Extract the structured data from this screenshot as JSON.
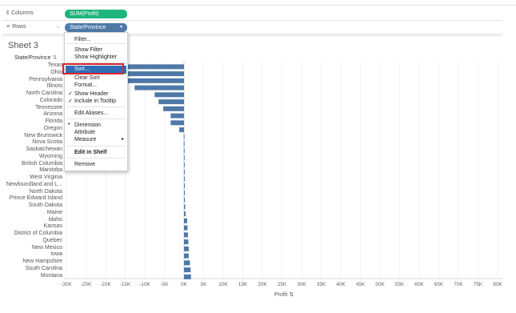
{
  "shelves": {
    "columns": {
      "label": "Columns",
      "icon": "columns-icon",
      "pill": "SUM(Profit)"
    },
    "rows": {
      "label": "Rows",
      "icon": "rows-icon",
      "pill": "State/Province",
      "pill_caret": "▾"
    }
  },
  "sheet": {
    "title": "Sheet 3",
    "row_header": "State/Province"
  },
  "menu": {
    "items": [
      {
        "label": "Filter..."
      },
      {
        "label": "Show Filter"
      },
      {
        "label": "Show Highlighter"
      },
      {
        "label": "Sort...",
        "highlighted": true
      },
      {
        "label": "Clear Sort"
      },
      {
        "label": "Format..."
      },
      {
        "label": "Show Header",
        "checked": true
      },
      {
        "label": "Include in Tooltip",
        "checked": true
      },
      {
        "label": "Edit Aliases..."
      },
      {
        "label": "Dimension",
        "selected": true
      },
      {
        "label": "Attribute"
      },
      {
        "label": "Measure",
        "submenu": true
      },
      {
        "label": "Edit in Shelf",
        "bold": true
      },
      {
        "label": "Remove"
      }
    ]
  },
  "colors": {
    "bar": "#4e79a7",
    "pill_green": "#1db57c",
    "pill_blue": "#4e79a7",
    "menu_highlight": "#2f6eb6",
    "sort_frame": "#d9232a"
  },
  "chart_data": {
    "type": "bar",
    "orientation": "horizontal",
    "xlabel": "Profit",
    "xlim": [
      -30000,
      80000
    ],
    "xticks": [
      "-30K",
      "-25K",
      "-20K",
      "-15K",
      "-10K",
      "-5K",
      "0K",
      "5K",
      "10K",
      "15K",
      "20K",
      "25K",
      "30K",
      "35K",
      "40K",
      "45K",
      "50K",
      "55K",
      "60K",
      "65K",
      "70K",
      "75K",
      "80K"
    ],
    "categories": [
      "Texas",
      "Ohio",
      "Pennsylvania",
      "Illinois",
      "North Carolina",
      "Colorado",
      "Tennessee",
      "Arizona",
      "Florida",
      "Oregon",
      "New Brunswick",
      "Nova Scotia",
      "Saskatchewan",
      "Wyoming",
      "British Columbia",
      "Manitoba",
      "West Virginia",
      "Newfoundland and L...",
      "North Dakota",
      "Prince Edward Island",
      "South Dakota",
      "Maine",
      "Idaho",
      "Kansas",
      "District of Columbia",
      "Quebec",
      "New Mexico",
      "Iowa",
      "New Hampshire",
      "South Carolina",
      "Montana"
    ],
    "values": [
      -25700,
      -16900,
      -15600,
      -12600,
      -7500,
      -6500,
      -5300,
      -3400,
      -3400,
      -1200,
      -80,
      -60,
      -50,
      -40,
      -30,
      -20,
      -10,
      0,
      100,
      200,
      300,
      400,
      800,
      900,
      1000,
      1100,
      1200,
      1200,
      1500,
      1700,
      1800
    ]
  }
}
